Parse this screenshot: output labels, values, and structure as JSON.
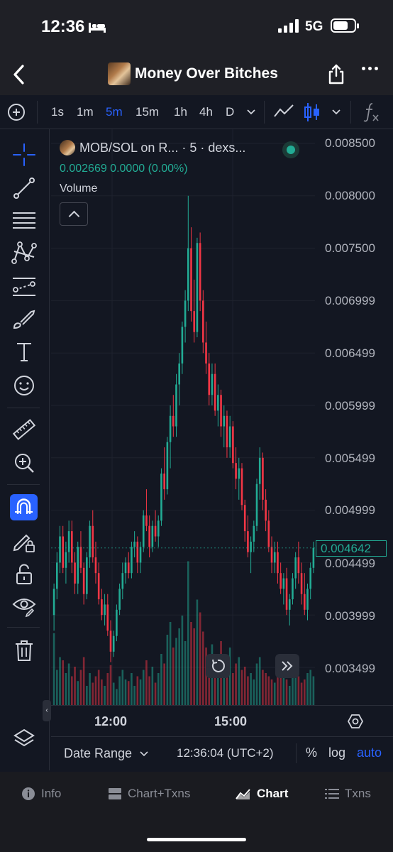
{
  "status_bar": {
    "time": "12:36",
    "network": "5G"
  },
  "nav": {
    "title": "Money Over Bitches"
  },
  "toolbar": {
    "intervals": [
      "1s",
      "1m",
      "5m",
      "15m",
      "1h",
      "4h",
      "D"
    ],
    "active_interval": "5m"
  },
  "legend": {
    "title": "MOB/SOL on R... · 5 · dexs...",
    "ohlc": "0.002669  0.0000 (0.00%)",
    "volume_label": "Volume"
  },
  "price_axis": {
    "labels": [
      "0.008500",
      "0.008000",
      "0.007500",
      "0.006999",
      "0.006499",
      "0.005999",
      "0.005499",
      "0.004999",
      "0.004499",
      "0.003999",
      "0.003499"
    ],
    "current_price": "0.004642"
  },
  "time_axis": {
    "labels": [
      "12:00",
      "15:00"
    ]
  },
  "bottom_bar": {
    "date_range": "Date Range",
    "clock": "12:36:04 (UTC+2)",
    "percent": "%",
    "log": "log",
    "auto": "auto"
  },
  "tabs": [
    {
      "label": "Info",
      "icon": "info-icon"
    },
    {
      "label": "Chart+Txns",
      "icon": "split-icon"
    },
    {
      "label": "Chart",
      "icon": "area-chart-icon",
      "active": true
    },
    {
      "label": "Txns",
      "icon": "list-icon"
    }
  ],
  "colors": {
    "up": "#22ab94",
    "down": "#f23645",
    "accent": "#2962ff",
    "background": "#131722"
  },
  "chart_data": {
    "type": "candlestick",
    "title": "MOB/SOL on R... · 5 · dexs...",
    "interval": "5m",
    "ylim": [
      0.0032,
      0.0086
    ],
    "x_ticks": [
      "12:00",
      "15:00"
    ],
    "candles": [
      [
        0.004,
        0.0043,
        0.00385,
        0.00425
      ],
      [
        0.00425,
        0.0046,
        0.00415,
        0.0045
      ],
      [
        0.0045,
        0.00485,
        0.0044,
        0.00475
      ],
      [
        0.00475,
        0.00485,
        0.0044,
        0.00445
      ],
      [
        0.00445,
        0.0047,
        0.0043,
        0.0046
      ],
      [
        0.0046,
        0.0049,
        0.0045,
        0.0048
      ],
      [
        0.0048,
        0.0049,
        0.0044,
        0.0045
      ],
      [
        0.0045,
        0.0046,
        0.0042,
        0.0043
      ],
      [
        0.0043,
        0.0047,
        0.0042,
        0.00465
      ],
      [
        0.00465,
        0.0048,
        0.0044,
        0.00445
      ],
      [
        0.00445,
        0.0045,
        0.0041,
        0.0042
      ],
      [
        0.0042,
        0.0046,
        0.00415,
        0.00455
      ],
      [
        0.00455,
        0.0049,
        0.00445,
        0.00485
      ],
      [
        0.00485,
        0.005,
        0.0045,
        0.00455
      ],
      [
        0.00455,
        0.0047,
        0.0043,
        0.0044
      ],
      [
        0.0044,
        0.0045,
        0.0041,
        0.00415
      ],
      [
        0.00415,
        0.00425,
        0.00395,
        0.004
      ],
      [
        0.004,
        0.0042,
        0.0039,
        0.0041
      ],
      [
        0.0041,
        0.0042,
        0.0038,
        0.00385
      ],
      [
        0.00385,
        0.00395,
        0.00355,
        0.00365
      ],
      [
        0.00365,
        0.00385,
        0.0036,
        0.0038
      ],
      [
        0.0038,
        0.0041,
        0.00375,
        0.00405
      ],
      [
        0.00405,
        0.0043,
        0.004,
        0.00425
      ],
      [
        0.00425,
        0.0045,
        0.00415,
        0.0044
      ],
      [
        0.0044,
        0.00455,
        0.0043,
        0.0045
      ],
      [
        0.0045,
        0.0046,
        0.00435,
        0.0044
      ],
      [
        0.0044,
        0.0047,
        0.00435,
        0.00465
      ],
      [
        0.00465,
        0.0048,
        0.00455,
        0.0047
      ],
      [
        0.0047,
        0.00475,
        0.0044,
        0.0045
      ],
      [
        0.0045,
        0.0047,
        0.0044,
        0.00465
      ],
      [
        0.00465,
        0.005,
        0.0046,
        0.00495
      ],
      [
        0.00495,
        0.0052,
        0.0048,
        0.00485
      ],
      [
        0.00485,
        0.00495,
        0.00455,
        0.00465
      ],
      [
        0.00465,
        0.0049,
        0.0046,
        0.00485
      ],
      [
        0.00485,
        0.005,
        0.0047,
        0.00475
      ],
      [
        0.00475,
        0.00495,
        0.00465,
        0.0049
      ],
      [
        0.0049,
        0.0054,
        0.00485,
        0.00535
      ],
      [
        0.00535,
        0.0056,
        0.0051,
        0.0052
      ],
      [
        0.0052,
        0.0057,
        0.00515,
        0.00565
      ],
      [
        0.00565,
        0.006,
        0.0054,
        0.0059
      ],
      [
        0.0059,
        0.0061,
        0.0057,
        0.0058
      ],
      [
        0.0058,
        0.0063,
        0.0057,
        0.0062
      ],
      [
        0.0062,
        0.0065,
        0.006,
        0.0064
      ],
      [
        0.0064,
        0.0068,
        0.0063,
        0.00675
      ],
      [
        0.00675,
        0.0071,
        0.0066,
        0.007
      ],
      [
        0.007,
        0.008,
        0.0069,
        0.0075
      ],
      [
        0.0075,
        0.0077,
        0.0068,
        0.0069
      ],
      [
        0.0069,
        0.0072,
        0.0066,
        0.0067
      ],
      [
        0.0067,
        0.0076,
        0.00665,
        0.00755
      ],
      [
        0.00755,
        0.00765,
        0.0069,
        0.007
      ],
      [
        0.007,
        0.0071,
        0.0065,
        0.0066
      ],
      [
        0.0066,
        0.0068,
        0.0063,
        0.0064
      ],
      [
        0.0064,
        0.0065,
        0.006,
        0.0061
      ],
      [
        0.0061,
        0.0064,
        0.006,
        0.0063
      ],
      [
        0.0063,
        0.0064,
        0.0059,
        0.00595
      ],
      [
        0.00595,
        0.0062,
        0.0058,
        0.0061
      ],
      [
        0.0061,
        0.00615,
        0.0057,
        0.0058
      ],
      [
        0.0058,
        0.006,
        0.0056,
        0.0059
      ],
      [
        0.0059,
        0.00595,
        0.0055,
        0.0056
      ],
      [
        0.0056,
        0.0059,
        0.0055,
        0.0058
      ],
      [
        0.0058,
        0.00585,
        0.0054,
        0.00545
      ],
      [
        0.00545,
        0.0056,
        0.0052,
        0.0053
      ],
      [
        0.0053,
        0.0055,
        0.0051,
        0.0054
      ],
      [
        0.0054,
        0.00545,
        0.005,
        0.00505
      ],
      [
        0.00505,
        0.0051,
        0.0047,
        0.0048
      ],
      [
        0.0048,
        0.00495,
        0.00455,
        0.0046
      ],
      [
        0.0046,
        0.00475,
        0.0044,
        0.0047
      ],
      [
        0.0047,
        0.0049,
        0.0046,
        0.00485
      ],
      [
        0.00485,
        0.0053,
        0.0048,
        0.00525
      ],
      [
        0.00525,
        0.0056,
        0.0051,
        0.0055
      ],
      [
        0.0055,
        0.00555,
        0.005,
        0.0051
      ],
      [
        0.0051,
        0.0052,
        0.0048,
        0.0049
      ],
      [
        0.0049,
        0.005,
        0.0046,
        0.00465
      ],
      [
        0.00465,
        0.00475,
        0.0044,
        0.0045
      ],
      [
        0.0045,
        0.0047,
        0.0044,
        0.0046
      ],
      [
        0.0046,
        0.0047,
        0.0043,
        0.0044
      ],
      [
        0.0044,
        0.0045,
        0.0042,
        0.00425
      ],
      [
        0.00425,
        0.0044,
        0.0041,
        0.00435
      ],
      [
        0.00435,
        0.00445,
        0.004,
        0.00405
      ],
      [
        0.00405,
        0.0042,
        0.0039,
        0.00415
      ],
      [
        0.00415,
        0.0044,
        0.0041,
        0.00435
      ],
      [
        0.00435,
        0.0046,
        0.00425,
        0.00455
      ],
      [
        0.00455,
        0.0047,
        0.0043,
        0.0044
      ],
      [
        0.0044,
        0.0045,
        0.0041,
        0.0042
      ],
      [
        0.0042,
        0.0044,
        0.004,
        0.00405
      ],
      [
        0.00405,
        0.0043,
        0.00395,
        0.00425
      ],
      [
        0.00425,
        0.0045,
        0.00415,
        0.00445
      ],
      [
        0.00445,
        0.0047,
        0.0044,
        0.00464
      ]
    ],
    "volume_relative": [
      0.45,
      0.22,
      0.3,
      0.28,
      0.2,
      0.26,
      0.18,
      0.24,
      0.15,
      0.22,
      0.3,
      0.12,
      0.2,
      0.14,
      0.18,
      0.22,
      0.16,
      0.12,
      0.2,
      0.25,
      0.14,
      0.1,
      0.18,
      0.22,
      0.16,
      0.15,
      0.2,
      0.12,
      0.18,
      0.16,
      0.22,
      0.28,
      0.18,
      0.24,
      0.14,
      0.2,
      0.32,
      0.26,
      0.44,
      0.52,
      0.36,
      0.42,
      0.48,
      0.56,
      0.4,
      0.9,
      0.52,
      0.48,
      0.66,
      0.58,
      0.46,
      0.36,
      0.3,
      0.38,
      0.26,
      0.32,
      0.4,
      0.28,
      0.3,
      0.36,
      0.2,
      0.26,
      0.3,
      0.22,
      0.24,
      0.18,
      0.2,
      0.16,
      0.26,
      0.3,
      0.22,
      0.2,
      0.18,
      0.16,
      0.14,
      0.22,
      0.18,
      0.26,
      0.16,
      0.12,
      0.2,
      0.24,
      0.18,
      0.14,
      0.16,
      0.2,
      0.22,
      0.18
    ]
  }
}
